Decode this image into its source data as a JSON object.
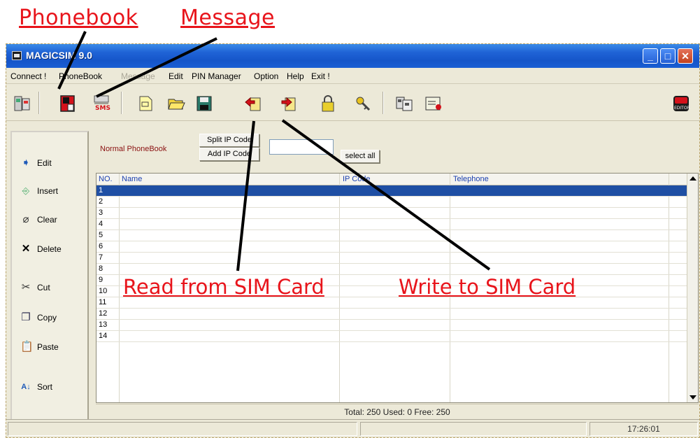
{
  "annotations": {
    "phonebook": "Phonebook",
    "message": "Message",
    "read_sim": "Read from SIM Card",
    "write_sim": "Write to SIM Card"
  },
  "window": {
    "title": "MAGICSIM 9.0"
  },
  "menu": {
    "items": [
      {
        "label": "Connect !",
        "disabled": false
      },
      {
        "label": "PhoneBook",
        "disabled": false
      },
      {
        "label": "Message",
        "disabled": true
      },
      {
        "label": "Edit",
        "disabled": false
      },
      {
        "label": "PIN Manager",
        "disabled": false
      },
      {
        "label": "Option",
        "disabled": false
      },
      {
        "label": "Help",
        "disabled": false
      },
      {
        "label": "Exit !",
        "disabled": false
      }
    ]
  },
  "toolbar": {
    "sms_label": "SMS",
    "editor_label": "EDITOR"
  },
  "left_panel": {
    "edit": "Edit",
    "insert": "Insert",
    "clear": "Clear",
    "delete": "Delete",
    "cut": "Cut",
    "copy": "Copy",
    "paste": "Paste",
    "sort": "Sort"
  },
  "controls": {
    "phonebook_mode": "Normal PhoneBook",
    "split_ip": "Split IP Code",
    "add_ip": "Add IP Code",
    "search_value": "",
    "select_all": "select all"
  },
  "grid": {
    "headers": {
      "no": "NO.",
      "name": "Name",
      "ip": "IP Code",
      "tel": "Telephone"
    },
    "rows": [
      "1",
      "2",
      "3",
      "4",
      "5",
      "6",
      "7",
      "8",
      "9",
      "10",
      "11",
      "12",
      "13",
      "14"
    ],
    "selected_row": 0
  },
  "totals": "Total: 250 Used: 0 Free: 250",
  "status": {
    "time": "17:26:01"
  },
  "colors": {
    "annotation": "#e8141b",
    "selection": "#1f4fa4",
    "titlebar": "#1555c9"
  }
}
